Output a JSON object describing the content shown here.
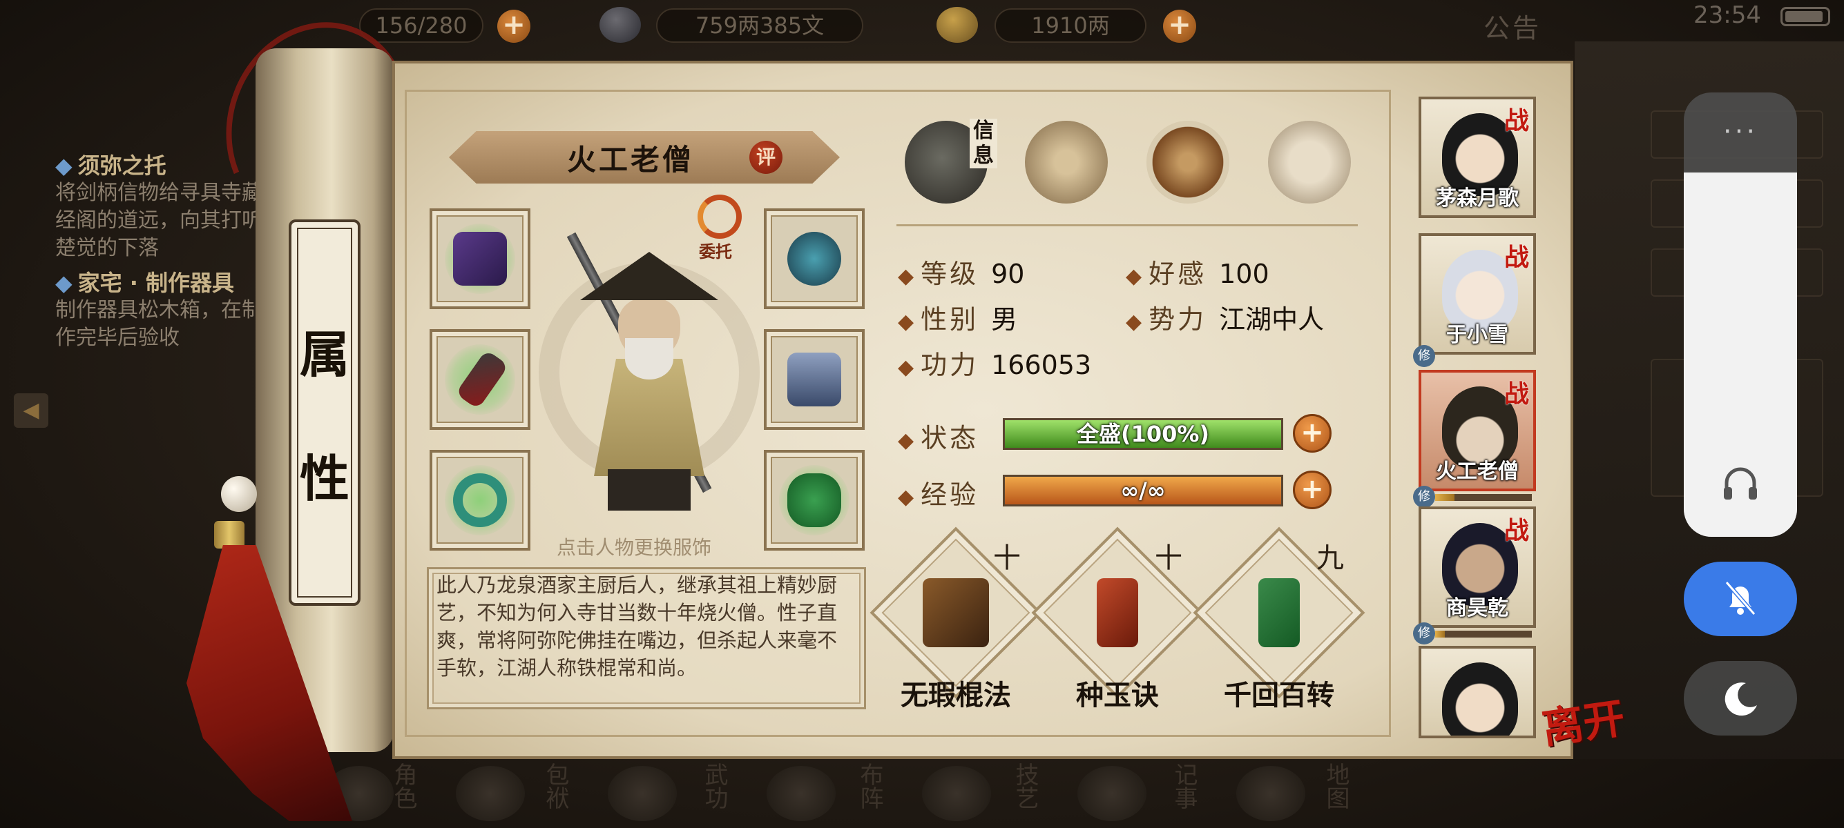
{
  "topbar": {
    "storage": "156/280",
    "coins": "759两385文",
    "gold": "1910两",
    "notice_label": "公告",
    "clock": "23:54"
  },
  "quest": {
    "items": [
      {
        "title": "须弥之托",
        "text": "将剑柄信物给寻具寺藏经阁的道远，向其打听楚觉的下落"
      },
      {
        "title": "家宅 · 制作器具",
        "text": "制作器具松木箱，在制作完毕后验收"
      }
    ]
  },
  "roller": {
    "char1": "属",
    "char2": "性"
  },
  "character": {
    "name": "火工老僧",
    "rate_label": "评",
    "entrust_label": "委托",
    "change_hint": "点击人物更换服饰",
    "description": "此人乃龙泉酒家主厨后人，继承其祖上精妙厨艺，不知为何入寺甘当数十年烧火僧。性子直爽，常将阿弥陀佛挂在嘴边，但杀起人来毫不手软，江湖人称铁棍常和尚。"
  },
  "tabs": {
    "info_label": "信息"
  },
  "stats": {
    "level_label": "等级",
    "level": "90",
    "favor_label": "好感",
    "favor": "100",
    "gender_label": "性别",
    "gender": "男",
    "faction_label": "势力",
    "faction": "江湖中人",
    "power_label": "功力",
    "power": "166053",
    "status_label": "状态",
    "status_value": "全盛(100%)",
    "status_fraction": 1.0,
    "exp_label": "经验",
    "exp_value": "∞/∞",
    "exp_fraction": 1.0
  },
  "skills": [
    {
      "name": "无瑕棍法",
      "level": "十"
    },
    {
      "name": "种玉诀",
      "level": "十"
    },
    {
      "name": "千回百转",
      "level": "九"
    }
  ],
  "roster": [
    {
      "name": "茅森月歌",
      "badge": "战"
    },
    {
      "name": "于小雪",
      "badge": "战"
    },
    {
      "name": "火工老僧",
      "badge": "战"
    },
    {
      "name": "商昊乾",
      "badge": "战"
    },
    {
      "name": "",
      "badge": ""
    }
  ],
  "roster_xiu": "修",
  "leave_label": "离开",
  "bottom_menu": [
    "角色",
    "包袱",
    "武功",
    "布阵",
    "技艺",
    "记事",
    "地图"
  ],
  "system_panel": {
    "menu_dots": "···",
    "volume_fraction": 0.82
  },
  "colors": {
    "mute_button": "#3a7be8",
    "bar_status": "#6fc040",
    "bar_exp": "#e0822e",
    "leave_red": "#c21a10"
  }
}
